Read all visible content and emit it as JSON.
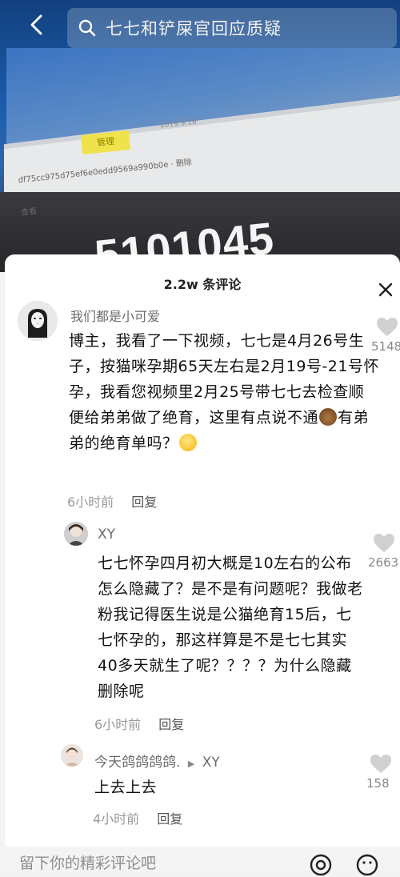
{
  "search": {
    "query": "七七和铲屎官回应质疑"
  },
  "photo": {
    "tag": "管理",
    "date": "2019.9.16",
    "hash": "df75cc975d75ef6e0edd9569a990b0e",
    "hash_suffix": "删除",
    "view": "查看",
    "number": "5101045"
  },
  "sheet": {
    "title": "2.2w 条评论"
  },
  "comments": [
    {
      "user": "我们都是小可爱",
      "text_main": "博主，我看了一下视频，七七是4月26号生子，按猫咪孕期65天左右是2月19号-21号怀孕，我看您视频里2月25号带七七去检查顺便给弟弟做了绝育，这里有点说不通",
      "text_after_emoji": "有弟弟的绝育单吗？",
      "time": "6小时前",
      "reply": "回复",
      "likes": "5148"
    },
    {
      "user": "XY",
      "text": "七七怀孕四月初大概是10左右的公布怎么隐藏了？是不是有问题呢？我做老粉我记得医生说是公猫绝育15后，七七怀孕的，那这样算是不是七七其实40多天就生了呢？？？？为什么隐藏删除呢",
      "time": "6小时前",
      "reply": "回复",
      "likes": "2663"
    },
    {
      "user": "今天鸽鸽鸽鸽.",
      "reply_to": "XY",
      "text": "上去上去",
      "time": "4小时前",
      "reply": "回复",
      "likes": "158"
    }
  ],
  "input": {
    "placeholder": "留下你的精彩评论吧"
  },
  "colors": {
    "sheet_bg": "#ffffff",
    "secondary_text": "#9a9a9a",
    "username": "#6b6b6b"
  }
}
